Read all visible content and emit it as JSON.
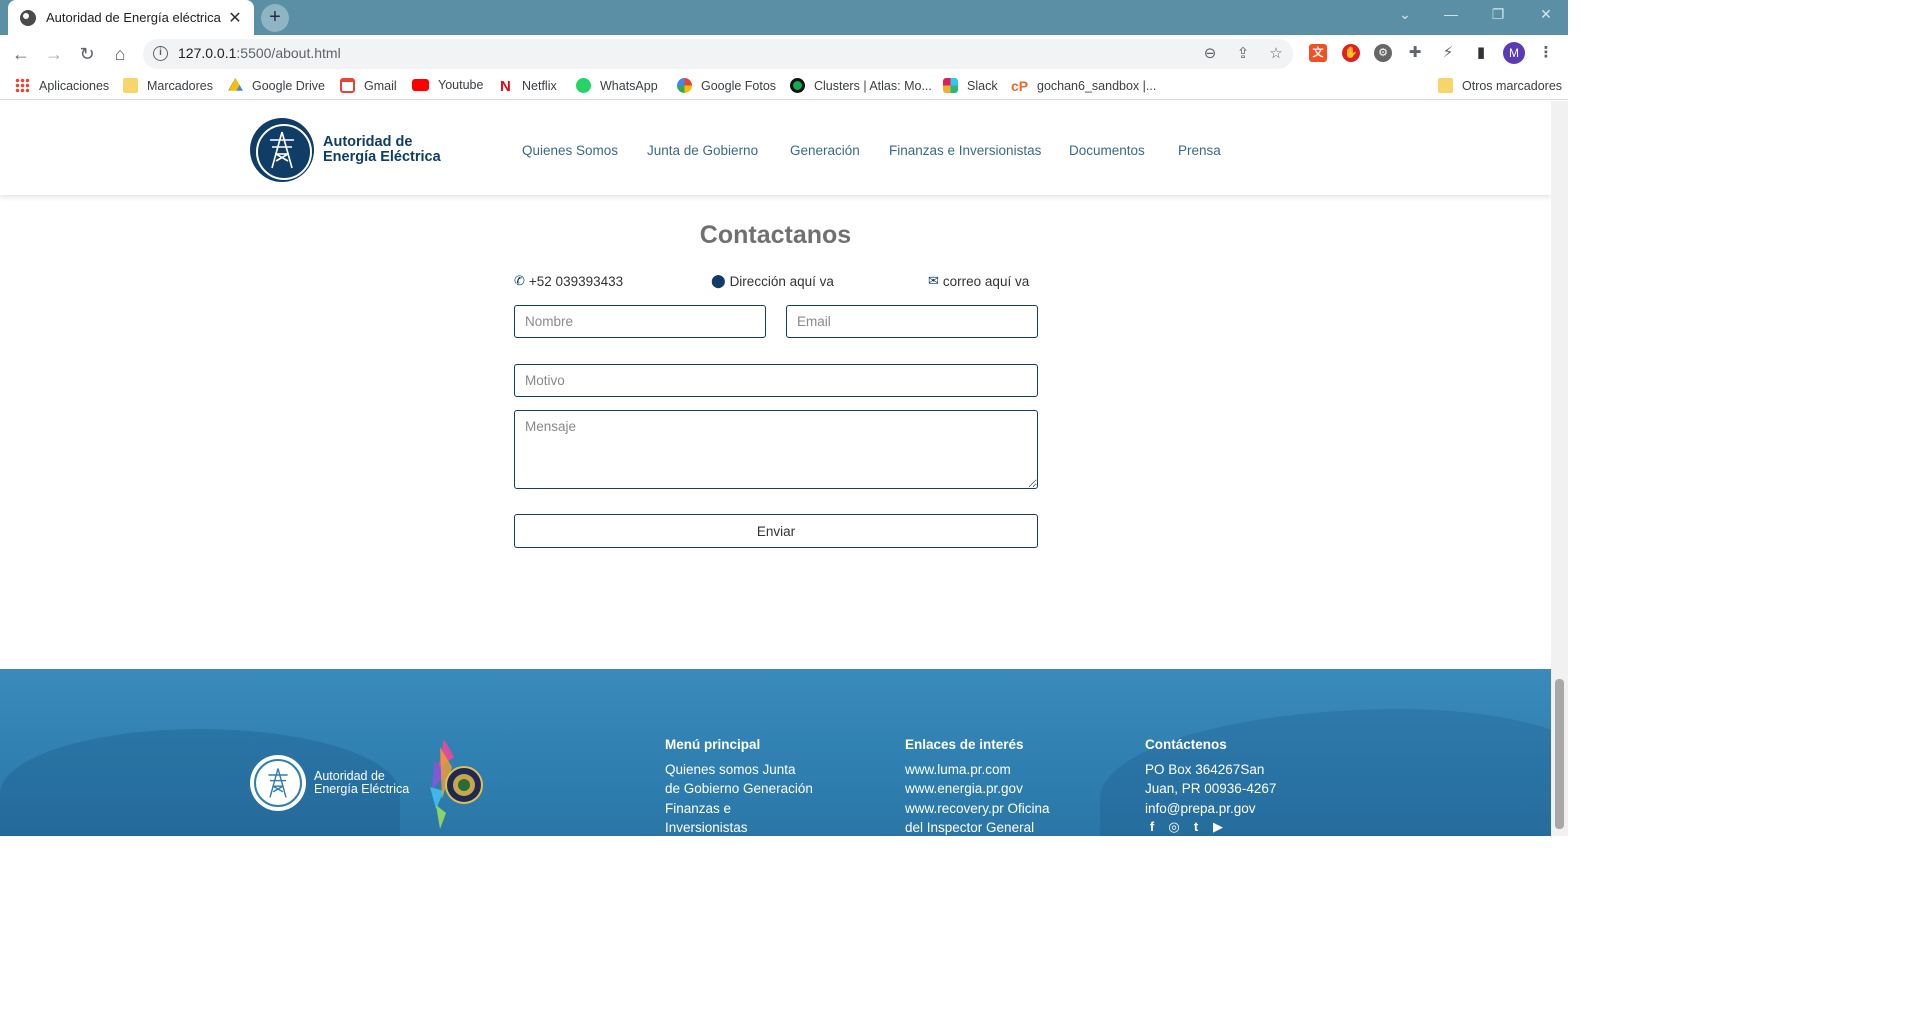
{
  "browser": {
    "tab_title": "Autoridad de Energía eléctrica",
    "tab_close": "✕",
    "new_tab": "+",
    "url_host": "127.0.0.1",
    "url_rest": ":5500/about.html",
    "profile_initial": "M",
    "bookmarks": [
      {
        "label": "Aplicaciones",
        "icon": "apps-grid-icon"
      },
      {
        "label": "Marcadores",
        "icon": "folder-icon"
      },
      {
        "label": "Google Drive",
        "icon": "google-drive-icon"
      },
      {
        "label": "Gmail",
        "icon": "gmail-icon"
      },
      {
        "label": "Youtube",
        "icon": "youtube-icon"
      },
      {
        "label": "Netflix",
        "icon": "netflix-icon"
      },
      {
        "label": "WhatsApp",
        "icon": "whatsapp-icon"
      },
      {
        "label": "Google Fotos",
        "icon": "google-photos-icon"
      },
      {
        "label": "Clusters | Atlas: Mo...",
        "icon": "mongodb-icon"
      },
      {
        "label": "Slack",
        "icon": "slack-icon"
      },
      {
        "label": "gochan6_sandbox |...",
        "icon": "codepen-icon"
      }
    ],
    "other_bookmarks": "Otros marcadores"
  },
  "header": {
    "logo_line1": "Autoridad de",
    "logo_line2": "Energía Eléctrica",
    "nav": [
      "Quienes Somos",
      "Junta de Gobierno",
      "Generación",
      "Finanzas e Inversionistas",
      "Documentos",
      "Prensa"
    ]
  },
  "contact": {
    "title": "Contactanos",
    "phone": "+52 039393433",
    "address": "Dirección aquí va",
    "email": "correo aquí va",
    "placeholders": {
      "name": "Nombre",
      "email": "Email",
      "reason": "Motivo",
      "message": "Mensaje"
    },
    "submit": "Enviar"
  },
  "footer": {
    "logo_line1": "Autoridad de",
    "logo_line2": "Energía Eléctrica",
    "menu": {
      "heading": "Menú principal",
      "lines": [
        "Quienes somos Junta",
        "de Gobierno Generación",
        "Finanzas e",
        "Inversionistas"
      ]
    },
    "links": {
      "heading": "Enlaces de interés",
      "lines": [
        "www.luma.pr.com",
        "www.energia.pr.gov",
        "www.recovery.pr Oficina",
        "del Inspector General"
      ]
    },
    "contact": {
      "heading": "Contáctenos",
      "lines": [
        "PO Box 364267San",
        "Juan, PR 00936-4267",
        "info@prepa.pr.gov"
      ]
    },
    "social": [
      "f",
      "◎",
      "t",
      "▶"
    ]
  },
  "colors": {
    "brand_navy": "#0f3d66",
    "footer_blue": "#2e7fb0",
    "tabstrip": "#5a8fa6"
  }
}
